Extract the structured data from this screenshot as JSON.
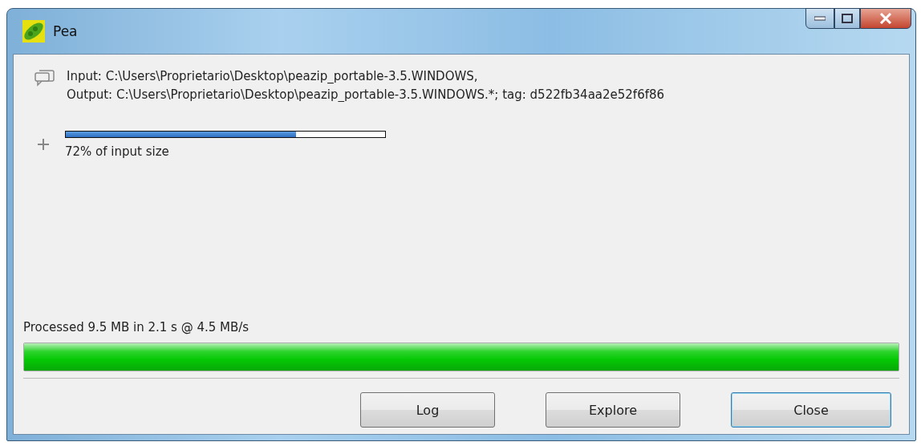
{
  "window": {
    "title": "Pea"
  },
  "info": {
    "lines": [
      "Input: C:\\Users\\Proprietario\\Desktop\\peazip_portable-3.5.WINDOWS,",
      "Output: C:\\Users\\Proprietario\\Desktop\\peazip_portable-3.5.WINDOWS.*; tag: d522fb34aa2e52f6f86"
    ]
  },
  "ratio": {
    "level": 0.72,
    "label": "72% of input size"
  },
  "status": {
    "text": "Processed 9.5 MB in 2.1 s @ 4.5 MB/s",
    "level": 1
  },
  "buttons": [
    {
      "label": "Log",
      "default": false
    },
    {
      "label": "Explore",
      "default": false
    },
    {
      "label": "Close",
      "default": true
    }
  ]
}
